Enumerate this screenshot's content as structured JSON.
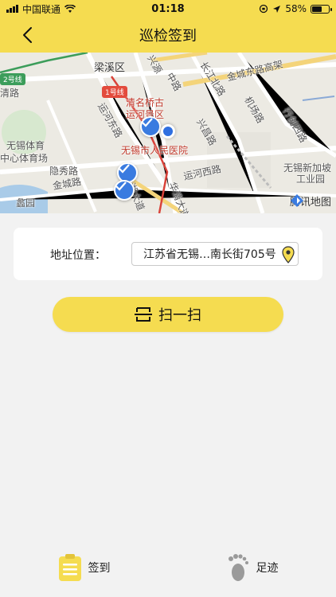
{
  "status_bar": {
    "carrier": "中国联通",
    "time": "01:18",
    "battery": "58%",
    "battery_level": 0.58
  },
  "header": {
    "title": "巡检签到"
  },
  "map": {
    "labels": {
      "liangxi": "梁溪区",
      "line1": "1号线",
      "qingming": "清名桥古",
      "yunhe_scenic": "运河景区",
      "xinyuan": "兴源",
      "zhonglu": "中路",
      "changjiang_beilu": "长江北路",
      "jincheng_east": "金城东路高架",
      "jichang": "机场路",
      "xingchuang": "行创四路",
      "yunhe_east": "运河东路",
      "xingchang": "兴昌路",
      "hospital": "无锡市人民医院",
      "wuxi_sports": "无锡体育",
      "sports_center": "中心体育场",
      "yinxiu": "隐秀路",
      "jincheng": "金城路",
      "yunhe_west": "运河西路",
      "lihu": "蠡湖大道",
      "huaqing": "华清大道",
      "xinjiapo": "无锡新加坡",
      "industrial_park": "工业园",
      "lijiyuan": "蠡园",
      "line2": "2号线",
      "qing": "清路",
      "tencent_maps": "腾讯地图"
    }
  },
  "address": {
    "label": "地址位置：",
    "value": "江苏省无锡…南长街705号"
  },
  "scan": {
    "label": "扫一扫"
  },
  "tabs": [
    {
      "label": "签到",
      "icon": "clipboard-icon"
    },
    {
      "label": "足迹",
      "icon": "footprint-icon"
    }
  ],
  "colors": {
    "primary": "#f5dc50",
    "marker_blue": "#3a7be0"
  }
}
